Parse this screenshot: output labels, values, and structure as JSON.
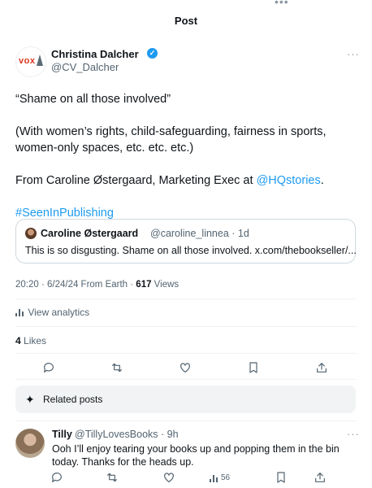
{
  "header": {
    "title": "Post",
    "top_more": "•••"
  },
  "author": {
    "name": "Christina Dalcher",
    "handle": "@CV_Dalcher",
    "avatar_text": "vox",
    "verified": true,
    "more": "···"
  },
  "post": {
    "line1": "“Shame on all those involved”",
    "line2": "(With women’s rights, child-safeguarding, fairness in sports, women-only spaces, etc. etc. etc.)",
    "line3_prefix": "From Caroline Østergaard, Marketing Exec at ",
    "line3_link": "@HQstories",
    "line3_suffix": ".",
    "hashtag": "#SeenInPublishing"
  },
  "quote": {
    "name": "Caroline Østergaard",
    "handle": "@caroline_linnea · 1d",
    "text": "This is so disgusting. Shame on all those involved. x.com/thebookseller/..."
  },
  "meta": {
    "time_date": "20:20 · 6/24/24 From Earth · ",
    "views_count": "617",
    "views_label": " Views"
  },
  "analytics_label": "View analytics",
  "likes": {
    "count": "4",
    "label": " Likes"
  },
  "actions": [
    "reply-icon",
    "repost-icon",
    "like-icon",
    "bookmark-icon",
    "share-icon"
  ],
  "related": {
    "label": "Related posts",
    "icon": "sparkle-icon"
  },
  "reply": {
    "name": "Tilly",
    "handle": "@TillyLovesBooks · 9h",
    "text": "Ooh I’ll enjoy tearing your books up and popping them in the bin today. Thanks for the heads up.",
    "views": "56",
    "more": "···"
  },
  "colors": {
    "link": "#1d9bf0",
    "secondary_text": "#536471",
    "text": "#0f1419",
    "verified": "#1d9bf0"
  }
}
